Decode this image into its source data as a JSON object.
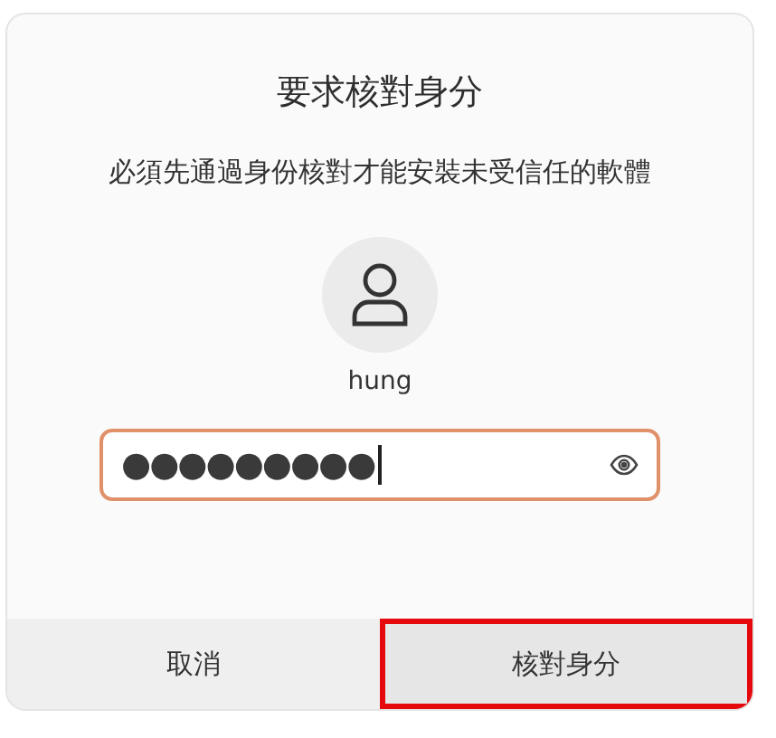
{
  "dialog": {
    "title": "要求核對身分",
    "message": "必須先通過身份核對才能安裝未受信任的軟體"
  },
  "user": {
    "name": "hung"
  },
  "password": {
    "value": "●●●●●●●●●",
    "focused": true
  },
  "buttons": [
    {
      "label": "取消",
      "highlighted": false
    },
    {
      "label": "核對身分",
      "highlighted": true
    }
  ]
}
